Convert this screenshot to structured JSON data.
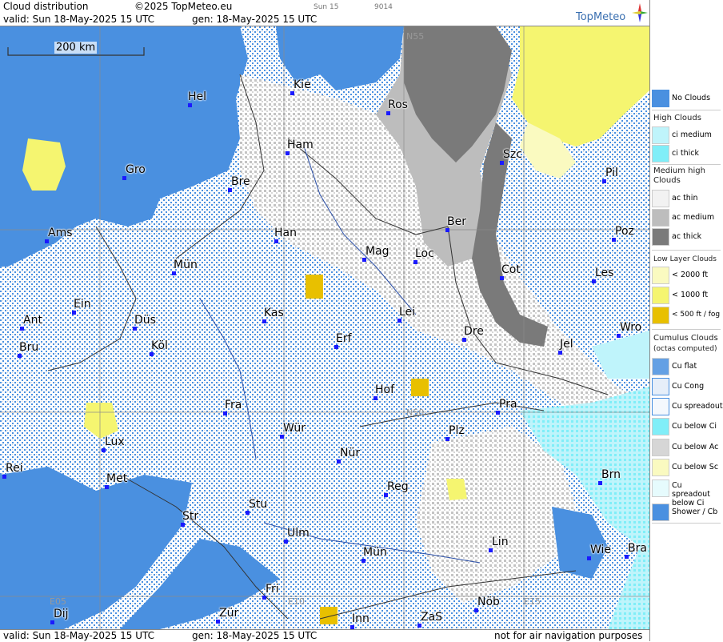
{
  "header": {
    "title": "Cloud distribution",
    "copyright": "©2025 TopMeteo.eu",
    "run_info": "Sun 15",
    "code": "9014",
    "valid": "valid:  Sun  18-May-2025  15 UTC",
    "gen": "gen: 18-May-2025 15 UTC",
    "logo_text": "TopMeteo"
  },
  "footer": {
    "valid": "valid:  Sun  18-May-2025  15 UTC",
    "gen": "gen: 18-May-2025 15 UTC",
    "disclaimer": "not for air navigation purposes"
  },
  "map": {
    "scale_label": "200 km",
    "grid_labels": [
      "N55",
      "N50",
      "E05",
      "E10",
      "E15"
    ],
    "cities": [
      "Kie",
      "Hel",
      "Ros",
      "Ham",
      "Szc",
      "Gro",
      "Bre",
      "Pil",
      "Ber",
      "Ams",
      "Han",
      "Poz",
      "Mag",
      "Loc",
      "Cot",
      "Mün",
      "Les",
      "Ein",
      "Kas",
      "Lei",
      "Ant",
      "Düs",
      "Dre",
      "Wro",
      "Köl",
      "Erf",
      "Bru",
      "Jel",
      "Hof",
      "Fra",
      "Pra",
      "Würz",
      "Plz",
      "Lux",
      "Nür",
      "Rei",
      "Met",
      "Reg",
      "Brn",
      "Stu",
      "Str",
      "Ulm",
      "Lin",
      "Wie",
      "Bra",
      "Mün2",
      "Fri",
      "Nöb",
      "Dij",
      "Zür",
      "Inn",
      "ZaS"
    ]
  },
  "city_names": {
    "Kie": "Kie",
    "Hel": "Hel",
    "Ros": "Ros",
    "Ham": "Ham",
    "Szc": "Szc",
    "Gro": "Gro",
    "Bre": "Bre",
    "Pil": "Pil",
    "Ber": "Ber",
    "Ams": "Ams",
    "Han": "Han",
    "Poz": "Poz",
    "Mag": "Mag",
    "Loc": "Loc",
    "Cot": "Cot",
    "Mün": "Mün",
    "Les": "Les",
    "Ein": "Ein",
    "Kas": "Kas",
    "Lei": "Lei",
    "Ant": "Ant",
    "Düs": "Düs",
    "Dre": "Dre",
    "Wro": "Wro",
    "Köl": "Köl",
    "Erf": "Erf",
    "Bru": "Bru",
    "Jel": "Jel",
    "Hof": "Hof",
    "Fra": "Fra",
    "Pra": "Pra",
    "Würz": "Wür",
    "Plz": "Plz",
    "Lux": "Lux",
    "Nür": "Nür",
    "Rei": "Rei",
    "Met": "Met",
    "Reg": "Reg",
    "Brn": "Brn",
    "Stu": "Stu",
    "Str": "Str",
    "Ulm": "Ulm",
    "Lin": "Lin",
    "Wie": "Wie",
    "Bra": "Bra",
    "Mün2": "Mün",
    "Fri": "Fri",
    "Nöb": "Nöb",
    "Dij": "Dij",
    "Zür": "Zür",
    "Inn": "Inn",
    "ZaS": "ZaS"
  },
  "legend": {
    "no_clouds": "No Clouds",
    "high_clouds": "High Clouds",
    "ci_medium": "ci medium",
    "ci_thick": "ci thick",
    "medium_high": "Medium high Clouds",
    "ac_thin": "ac thin",
    "ac_medium": "ac medium",
    "ac_thick": "ac thick",
    "low_layer": "Low Layer Clouds",
    "lt2000": "< 2000 ft",
    "lt1000": "< 1000 ft",
    "lt500": "< 500 ft / fog",
    "cumulus": "Cumulus Clouds",
    "octas": "(octas computed)",
    "cu_flat": "Cu flat",
    "cu_cong": "Cu Cong",
    "cu_spread": "Cu spreadout",
    "cu_below_ci": "Cu below Ci",
    "cu_below_ac": "Cu below Ac",
    "cu_below_sc": "Cu below Sc",
    "cu_spread_ci": "Cu spreadout below Ci",
    "shower": "Shower / Cb"
  },
  "colors": {
    "no_clouds": "#4a90e0",
    "ci_medium": "#bff4fb",
    "ci_thick": "#80eef8",
    "ac_thin": "#f2f2f2",
    "ac_medium": "#bdbdbd",
    "ac_thick": "#7a7a7a",
    "lt2000": "#fafac0",
    "lt1000": "#f5f570",
    "lt500": "#e8c000",
    "city_dot": "#1a1aff"
  }
}
